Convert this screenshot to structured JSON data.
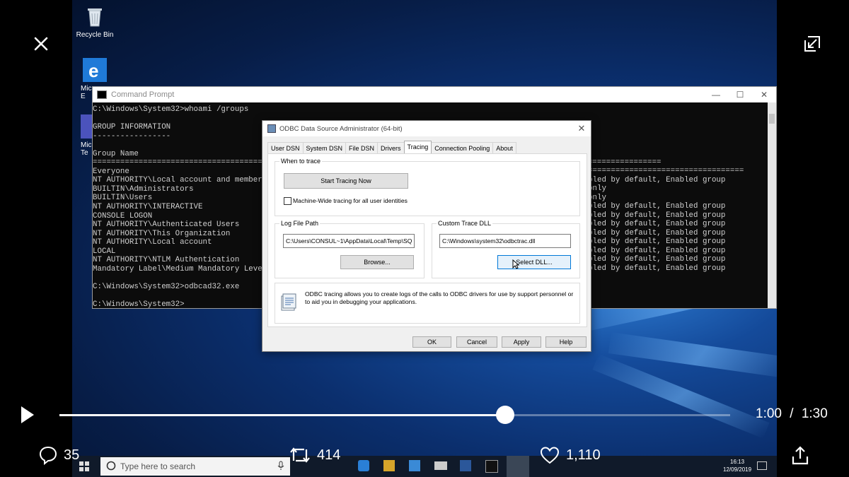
{
  "player": {
    "current_time": "1:00",
    "separator": "/",
    "total_time": "1:30",
    "progress": 0.665
  },
  "actions": {
    "replies": "35",
    "retweets": "414",
    "likes": "1,110"
  },
  "desktop": {
    "icons": [
      {
        "label": "Recycle Bin"
      },
      {
        "label": "Mic E"
      },
      {
        "label": "Mic Te"
      }
    ]
  },
  "cmd": {
    "title": "Command Prompt",
    "left_lines": "C:\\Windows\\System32>whoami /groups\n\nGROUP INFORMATION\n-----------------\n\nGroup Name\n============================================================================================================================\nEveryone\nNT AUTHORITY\\Local account and member o\nBUILTIN\\Administrators\nBUILTIN\\Users\nNT AUTHORITY\\INTERACTIVE\nCONSOLE LOGON\nNT AUTHORITY\\Authenticated Users\nNT AUTHORITY\\This Organization\nNT AUTHORITY\\Local account\nLOCAL\nNT AUTHORITY\\NTLM Authentication\nMandatory Label\\Medium Mandatory Level\n\nC:\\Windows\\System32>odbcad32.exe\n\nC:\\Windows\\System32>",
    "right_lines": "==================================\nbled by default, Enabled group\nonly\nonly\nbled by default, Enabled group\nbled by default, Enabled group\nbled by default, Enabled group\nbled by default, Enabled group\nbled by default, Enabled group\nbled by default, Enabled group\nbled by default, Enabled group\nbled by default, Enabled group"
  },
  "dialog": {
    "title": "ODBC Data Source Administrator (64-bit)",
    "tabs": [
      "User DSN",
      "System DSN",
      "File DSN",
      "Drivers",
      "Tracing",
      "Connection Pooling",
      "About"
    ],
    "when_to_trace": "When to trace",
    "start_tracing": "Start Tracing Now",
    "machine_wide": "Machine-Wide tracing for all user identities",
    "log_file_path": "Log File Path",
    "log_path_value": "C:\\Users\\CONSUL~1\\AppData\\Local\\Temp\\SQ",
    "browse": "Browse...",
    "custom_trace_dll": "Custom Trace DLL",
    "dll_value": "C:\\Windows\\system32\\odbctrac.dll",
    "select_dll": "Select DLL...",
    "info_text": "ODBC tracing allows you to create logs of the calls to ODBC drivers for use by support personnel or to aid you in debugging your applications.",
    "ok": "OK",
    "cancel": "Cancel",
    "apply": "Apply",
    "help": "Help"
  },
  "taskbar": {
    "search_placeholder": "Type here to search",
    "time": "16:13",
    "date": "12/09/2019"
  }
}
